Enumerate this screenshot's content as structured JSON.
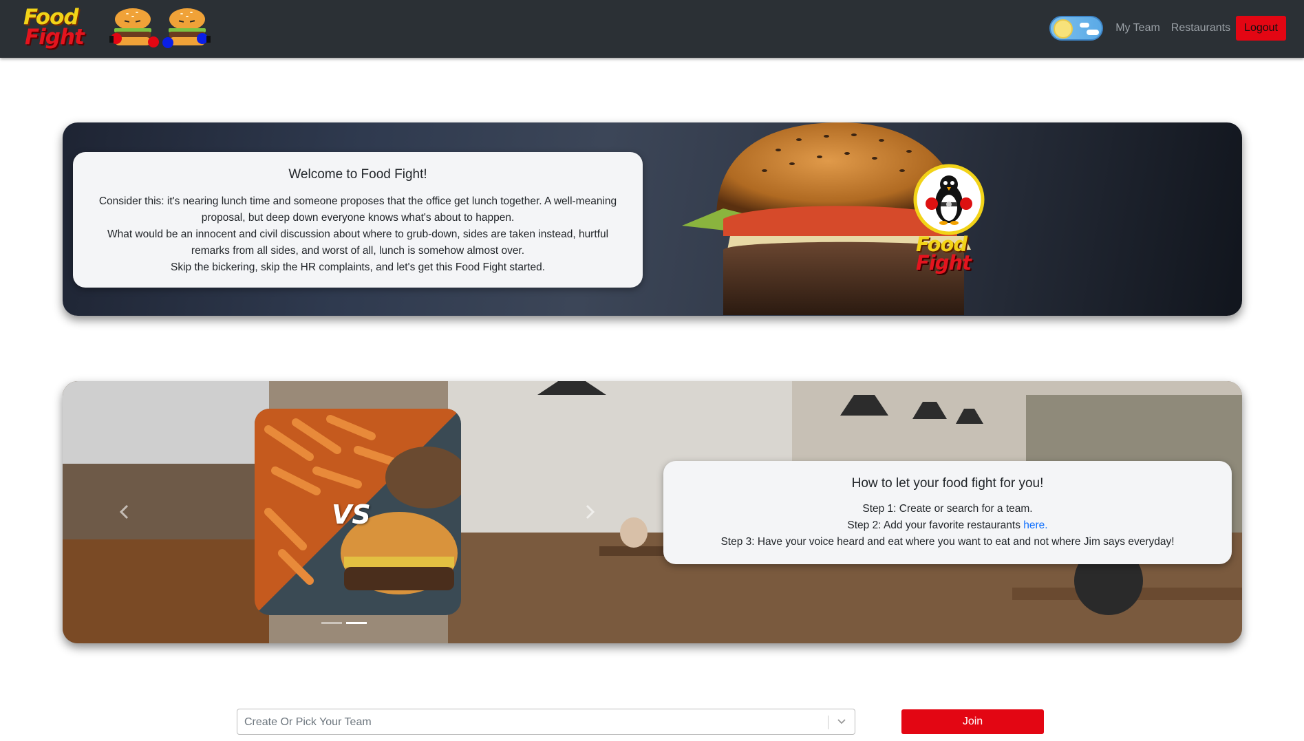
{
  "navbar": {
    "brand_line1": "Food",
    "brand_line2": "Fight",
    "links": [
      "My Team",
      "Restaurants"
    ],
    "logout_label": "Logout"
  },
  "hero": {
    "logo_line1": "Food",
    "logo_line2": "Fight",
    "welcome_title": "Welcome to Food Fight!",
    "welcome_paragraphs": [
      "Consider this: it's nearing lunch time and someone proposes that the office get lunch together. A well-meaning proposal, but deep down everyone knows what's about to happen.",
      "What would be an innocent and civil discussion about where to grub-down, sides are taken instead, hurtful remarks from all sides, and worst of all, lunch is somehow almost over.",
      "Skip the bickering, skip the HR complaints, and let's get this Food Fight started."
    ]
  },
  "howto": {
    "vs_label": "VS",
    "title": "How to let your food fight for you!",
    "step1": "Step 1: Create or search for a team.",
    "step2_prefix": "Step 2: Add your favorite restaurants ",
    "step2_link": "here.",
    "step3": "Step 3: Have your voice heard and eat where you want to eat and not where Jim says everyday!",
    "carousel_slide_count": 2,
    "carousel_active_slide": 2
  },
  "team_form": {
    "placeholder": "Create Or Pick Your Team",
    "join_label": "Join"
  },
  "colors": {
    "navbar_bg": "#2b3035",
    "accent_red": "#e30613",
    "link_blue": "#0d6efd",
    "brand_yellow": "#f2d318"
  },
  "icons": [
    "burger-boxer-red-icon",
    "burger-boxer-blue-icon",
    "sun-icon",
    "cloud-icon",
    "penguin-boxer-icon",
    "chevron-left-icon",
    "chevron-right-icon",
    "chevron-down-icon"
  ]
}
